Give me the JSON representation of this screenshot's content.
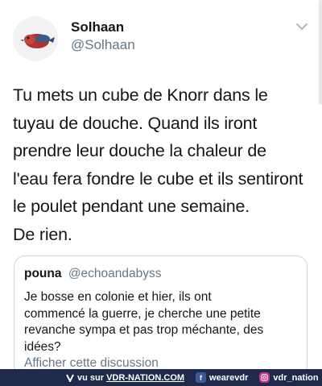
{
  "tweet": {
    "author_name": "Solhaan",
    "author_handle": "@Solhaan",
    "avatar_icon": "bird-avatar-icon",
    "menu_icon": "chevron-down-icon",
    "lines": [
      "Tu mets un cube de Knorr dans le",
      "tuyau de douche. Quand ils iront",
      "prendre leur douche la chaleur de",
      "l'eau fera fondre le cube et ils sentiront",
      "le poulet pendant une semaine.",
      "De rien."
    ]
  },
  "quoted": {
    "author_name": "pouna",
    "author_handle": "@echoandabyss",
    "lines": [
      "Je bosse en colonie et hier, ils ont",
      "commencé la guerre, je cherche une petite",
      "revanche sympa et pas trop méchante, des",
      "idées?"
    ],
    "show_thread": "Afficher cette discussion"
  },
  "footer": {
    "site_prefix": "vu sur",
    "site": "VDR-NATION.COM",
    "facebook": "wearevdr",
    "instagram": "vdr_nation",
    "colors": {
      "bar": "#1f2a4a",
      "instagram": "#c13584",
      "facebook": "#3b5998"
    }
  }
}
